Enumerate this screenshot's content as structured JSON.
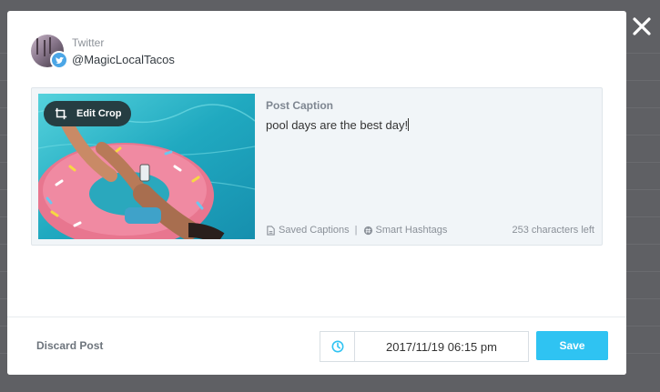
{
  "account": {
    "network": "Twitter",
    "handle": "@MagicLocalTacos",
    "badge_icon": "twitter-icon"
  },
  "post": {
    "edit_crop_label": "Edit Crop",
    "caption_label": "Post Caption",
    "caption_value": "pool days are the best day!",
    "saved_captions_label": "Saved Captions",
    "separator": "|",
    "smart_hashtags_label": "Smart Hashtags",
    "chars_left": "253 characters left"
  },
  "footer": {
    "discard_label": "Discard Post",
    "datetime_value": "2017/11/19 06:15 pm",
    "save_label": "Save"
  },
  "colors": {
    "accent": "#2fc3f2",
    "twitter": "#4ba6e6",
    "overlay": "#5f6064",
    "edit_crop_bg": "#263d42"
  }
}
